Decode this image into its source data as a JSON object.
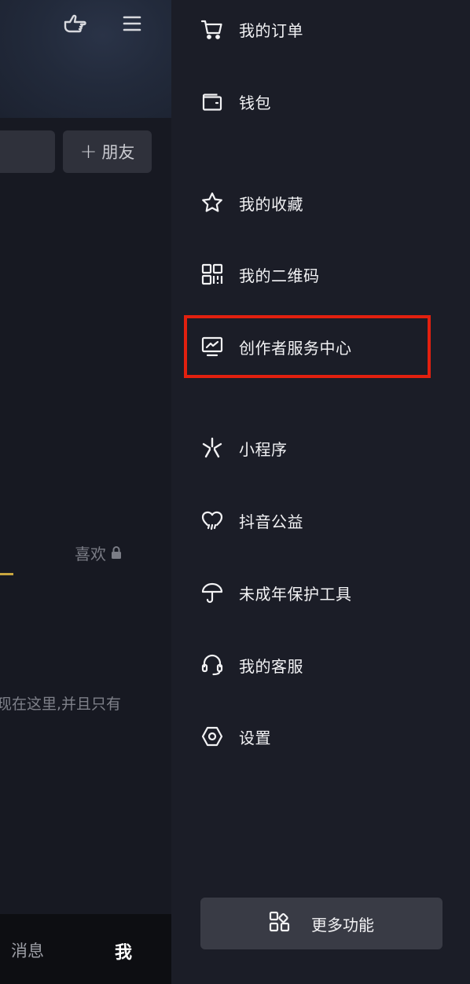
{
  "left_panel": {
    "add_friend": {
      "plus": "+",
      "label": "朋友"
    },
    "likes_tab": "喜欢",
    "empty_hint": "现在这里,并且只有",
    "bottom_tabs": {
      "messages": "消息",
      "me": "我"
    }
  },
  "drawer": {
    "items": [
      {
        "label": "我的订单",
        "icon": "cart-icon"
      },
      {
        "label": "钱包",
        "icon": "wallet-icon"
      },
      {
        "label": "我的收藏",
        "icon": "star-icon"
      },
      {
        "label": "我的二维码",
        "icon": "qr-code-icon"
      },
      {
        "label": "创作者服务中心",
        "icon": "monitor-chart-icon",
        "highlighted": true
      },
      {
        "label": "小程序",
        "icon": "mini-program-icon"
      },
      {
        "label": "抖音公益",
        "icon": "heart-charity-icon"
      },
      {
        "label": "未成年保护工具",
        "icon": "umbrella-icon"
      },
      {
        "label": "我的客服",
        "icon": "headset-icon"
      },
      {
        "label": "设置",
        "icon": "hexagon-settings-icon"
      }
    ],
    "more_button": {
      "label": "更多功能",
      "icon": "grid-icon"
    }
  },
  "colors": {
    "highlight": "#e2200f",
    "drawer_bg": "#1b1d27",
    "accent_underline": "#c9a63f"
  }
}
